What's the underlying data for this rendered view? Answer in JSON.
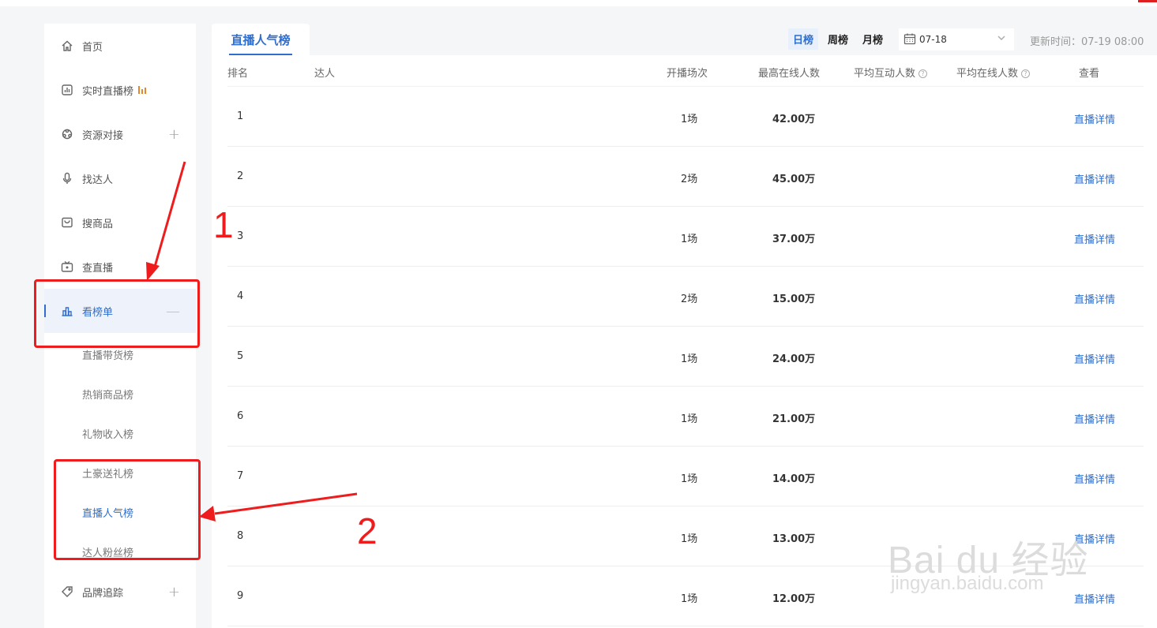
{
  "sidebar": {
    "items": [
      {
        "label": "首页",
        "icon": "home-icon"
      },
      {
        "label": "实时直播榜",
        "icon": "live-chart-icon"
      },
      {
        "label": "资源对接",
        "icon": "resource-icon",
        "expand": "+"
      },
      {
        "label": "找达人",
        "icon": "microphone-icon"
      },
      {
        "label": "搜商品",
        "icon": "bag-icon"
      },
      {
        "label": "查直播",
        "icon": "tv-icon"
      },
      {
        "label": "看榜单",
        "icon": "ranking-chart-icon",
        "expand": "—"
      },
      {
        "label": "品牌追踪",
        "icon": "tag-icon",
        "expand": "+"
      }
    ],
    "sub_items": [
      {
        "label": "直播带货榜"
      },
      {
        "label": "热销商品榜"
      },
      {
        "label": "礼物收入榜"
      },
      {
        "label": "土豪送礼榜"
      },
      {
        "label": "直播人气榜"
      },
      {
        "label": "达人粉丝榜"
      }
    ]
  },
  "main": {
    "tab_title": "直播人气榜",
    "period_tabs": [
      "日榜",
      "周榜",
      "月榜"
    ],
    "date_value": "07-18",
    "update_time": "更新时间：07-19 08:00",
    "columns": {
      "rank": "排名",
      "influencer": "达人",
      "sessions": "开播场次",
      "peak_online": "最高在线人数",
      "avg_interact": "平均互动人数",
      "avg_online": "平均在线人数",
      "view": "查看"
    },
    "rows": [
      {
        "rank": "1",
        "sessions": "1场",
        "peak": "42.00万",
        "link": "直播详情"
      },
      {
        "rank": "2",
        "sessions": "2场",
        "peak": "45.00万",
        "link": "直播详情"
      },
      {
        "rank": "3",
        "sessions": "1场",
        "peak": "37.00万",
        "link": "直播详情"
      },
      {
        "rank": "4",
        "sessions": "2场",
        "peak": "15.00万",
        "link": "直播详情"
      },
      {
        "rank": "5",
        "sessions": "1场",
        "peak": "24.00万",
        "link": "直播详情"
      },
      {
        "rank": "6",
        "sessions": "1场",
        "peak": "21.00万",
        "link": "直播详情"
      },
      {
        "rank": "7",
        "sessions": "1场",
        "peak": "14.00万",
        "link": "直播详情"
      },
      {
        "rank": "8",
        "sessions": "1场",
        "peak": "13.00万",
        "link": "直播详情"
      },
      {
        "rank": "9",
        "sessions": "1场",
        "peak": "12.00万",
        "link": "直播详情"
      }
    ]
  },
  "annotations": {
    "step1": "1",
    "step2": "2",
    "color": "#ee1c1c"
  },
  "watermark": {
    "brand": "Bai du 经验",
    "url": "jingyan.baidu.com"
  },
  "colors": {
    "accent": "#2f6ecf",
    "live_bars": "#e8862a"
  }
}
